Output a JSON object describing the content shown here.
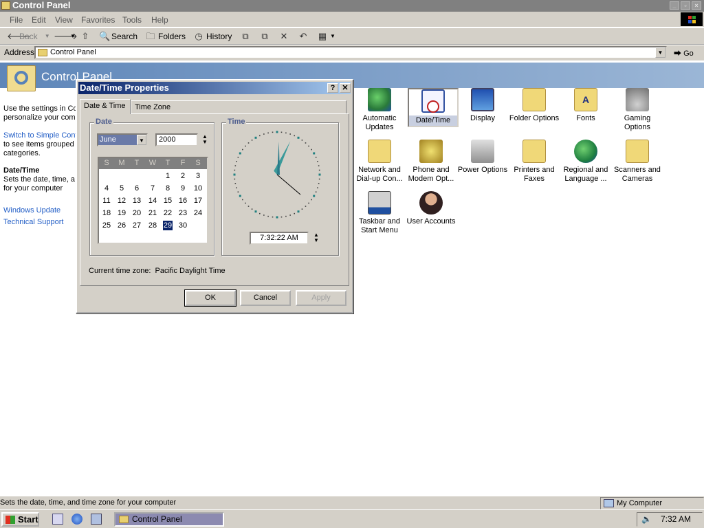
{
  "window": {
    "title": "Control Panel"
  },
  "menu": [
    "File",
    "Edit",
    "View",
    "Favorites",
    "Tools",
    "Help"
  ],
  "toolbar": {
    "back": "Back",
    "search": "Search",
    "folders": "Folders",
    "history": "History"
  },
  "address": {
    "label": "Address",
    "value": "Control Panel",
    "go": "Go"
  },
  "banner": {
    "title": "Control Panel"
  },
  "leftpane": {
    "intro1": "Use the settings in Co",
    "intro2": "personalize your comp",
    "switch_link1": "Switch to Simple Cont",
    "switch_text1": "to see items grouped",
    "switch_text2": "categories.",
    "selected_title": "Date/Time",
    "desc1": "Sets the date, time, a",
    "desc2": "for your computer",
    "link_update": "Windows Update",
    "link_support": "Technical Support"
  },
  "icons": [
    {
      "label1": "Automatic",
      "label2": "Updates",
      "icon": "automatic-updates-icon"
    },
    {
      "label1": "Date/Time",
      "label2": "",
      "icon": "date-time-icon",
      "selected": true
    },
    {
      "label1": "Display",
      "label2": "",
      "icon": "display-icon"
    },
    {
      "label1": "Folder Options",
      "label2": "",
      "icon": "folder-options-icon"
    },
    {
      "label1": "Fonts",
      "label2": "",
      "icon": "fonts-icon"
    },
    {
      "label1": "Gaming",
      "label2": "Options",
      "icon": "gaming-options-icon"
    },
    {
      "label1": "Network and",
      "label2": "Dial-up Con...",
      "icon": "network-icon"
    },
    {
      "label1": "Phone and",
      "label2": "Modem Opt...",
      "icon": "phone-modem-icon"
    },
    {
      "label1": "Power Options",
      "label2": "",
      "icon": "power-options-icon"
    },
    {
      "label1": "Printers and",
      "label2": "Faxes",
      "icon": "printers-icon"
    },
    {
      "label1": "Regional and",
      "label2": "Language ...",
      "icon": "regional-icon"
    },
    {
      "label1": "Scanners and",
      "label2": "Cameras",
      "icon": "scanners-icon"
    },
    {
      "label1": "Taskbar and",
      "label2": "Start Menu",
      "icon": "taskbar-icon"
    },
    {
      "label1": "User Accounts",
      "label2": "",
      "icon": "user-accounts-icon"
    }
  ],
  "dialog": {
    "title": "Date/Time Properties",
    "tabs": [
      "Date & Time",
      "Time Zone"
    ],
    "date_group": "Date",
    "time_group": "Time",
    "month": "June",
    "year": "2000",
    "weekdays": [
      "S",
      "M",
      "T",
      "W",
      "T",
      "F",
      "S"
    ],
    "days": [
      "1",
      "2",
      "3",
      "4",
      "5",
      "6",
      "7",
      "8",
      "9",
      "10",
      "11",
      "12",
      "13",
      "14",
      "15",
      "16",
      "17",
      "18",
      "19",
      "20",
      "21",
      "22",
      "23",
      "24",
      "25",
      "26",
      "27",
      "28",
      "29",
      "30"
    ],
    "first_weekday": 4,
    "selected_day": "29",
    "time": "7:32:22 AM",
    "timezone_label": "Current time zone:",
    "timezone_value": "Pacific Daylight Time",
    "ok": "OK",
    "cancel": "Cancel",
    "apply": "Apply"
  },
  "status": {
    "text": "Sets the date, time, and time zone for your computer",
    "zone": "My Computer"
  },
  "taskbar": {
    "start": "Start",
    "task": "Control Panel",
    "clock": "7:32 AM"
  }
}
